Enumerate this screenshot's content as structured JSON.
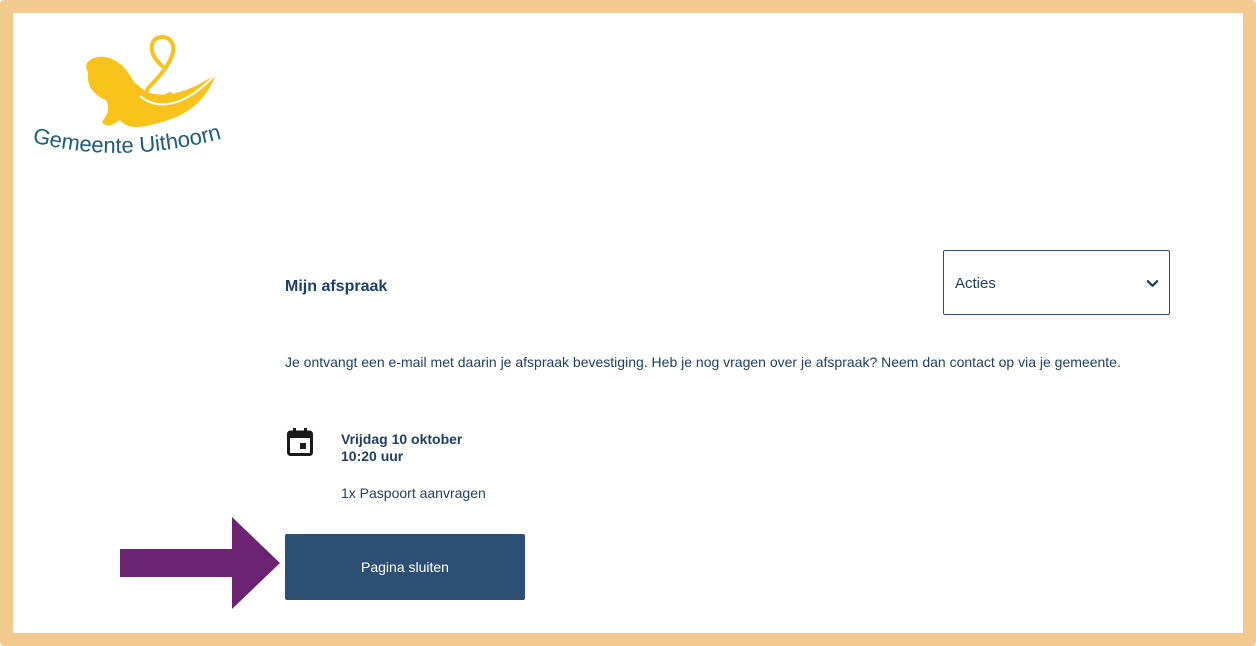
{
  "logo": {
    "text": "Gemeente Uithoorn",
    "colors": {
      "figure": "#f7c21a",
      "text": "#1f5c7a"
    }
  },
  "appointment": {
    "title": "Mijn afspraak",
    "actions": {
      "selected": "Acties"
    },
    "intro": "Je ontvangt een e-mail met daarin je afspraak bevestiging. Heb je nog vragen over je afspraak? Neem dan contact op via je gemeente.",
    "date": "Vrijdag 10 oktober",
    "time": "10:20 uur",
    "service": "1x Paspoort aanvragen",
    "close_label": "Pagina sluiten"
  },
  "annotation": {
    "arrow_color": "#6b2473",
    "frame_color": "#f2c98f"
  },
  "icons": [
    "calendar-icon",
    "chevron-down-icon",
    "pointer-arrow"
  ],
  "colors": {
    "primary": "#2d4f73",
    "text": "#1f3f63"
  }
}
